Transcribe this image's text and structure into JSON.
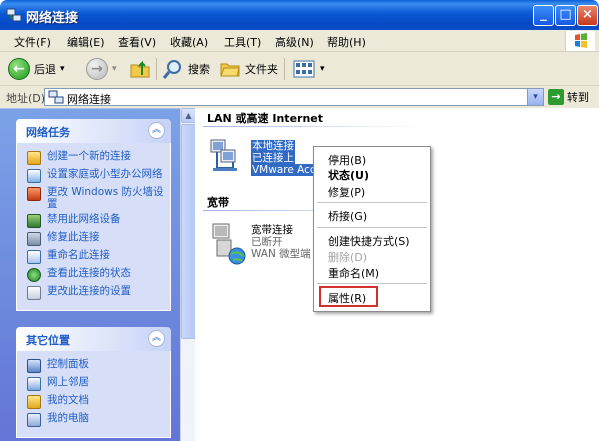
{
  "window": {
    "title": "网络连接",
    "min_label": "_",
    "max_label": "□",
    "close_label": "×"
  },
  "menu": {
    "items": [
      "文件(F)",
      "编辑(E)",
      "查看(V)",
      "收藏(A)",
      "工具(T)",
      "高级(N)",
      "帮助(H)"
    ]
  },
  "toolbar": {
    "back_label": "后退",
    "back_icon": "←",
    "forward_icon": "→",
    "search_label": "搜索",
    "folders_label": "文件夹",
    "dropdown_glyph": "▾"
  },
  "address": {
    "label": "地址(D)",
    "value": "网络连接",
    "go_label": "转到",
    "go_icon": "→",
    "drop_icon": "▾"
  },
  "tasks_panel": {
    "title": "网络任务",
    "collapse_icon": "︽",
    "items": [
      "创建一个新的连接",
      "设置家庭或小型办公网络",
      "更改 Windows 防火墙设置",
      "禁用此网络设备",
      "修复此连接",
      "重命名此连接",
      "查看此连接的状态",
      "更改此连接的设置"
    ]
  },
  "places_panel": {
    "title": "其它位置",
    "collapse_icon": "︽",
    "items": [
      "控制面板",
      "网上邻居",
      "我的文档",
      "我的电脑"
    ]
  },
  "content": {
    "group1_title": "LAN 或高速 Internet",
    "group2_title": "宽带",
    "lan": {
      "name": "本地连接",
      "status": "已连接上",
      "device": "VMware Acc"
    },
    "broadband": {
      "name": "宽带连接",
      "status": "已断开",
      "device": "WAN 微型端"
    }
  },
  "context_menu": {
    "items": {
      "disable": "停用(B)",
      "status": "状态(U)",
      "repair": "修复(P)",
      "bridge": "桥接(G)",
      "shortcut": "创建快捷方式(S)",
      "delete": "删除(D)",
      "rename": "重命名(M)",
      "properties": "属性(R)"
    }
  },
  "colors": {
    "accent": "#215dc6",
    "highlight_box": "#d2312b",
    "selection": "#316ac5"
  }
}
